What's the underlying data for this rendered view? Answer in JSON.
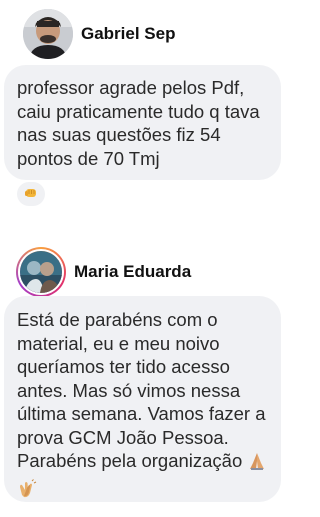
{
  "comments": [
    {
      "author": "Gabriel Sep",
      "text": "professor agrade pelos Pdf, caiu praticamente tudo q tava nas suas questões fiz 54 pontos de 70 Tmj",
      "reaction_icon": "fist-bump-emoji"
    },
    {
      "author": "Maria Eduarda",
      "text": "Está de parabéns com o material, eu e meu noivo queríamos ter tido acesso antes. Mas só vimos nessa última semana. Vamos fazer a prova GCM João Pessoa. Parabéns pela organização",
      "trailing_emoji": [
        "folded-hands-emoji",
        "clapping-hands-emoji"
      ]
    }
  ]
}
